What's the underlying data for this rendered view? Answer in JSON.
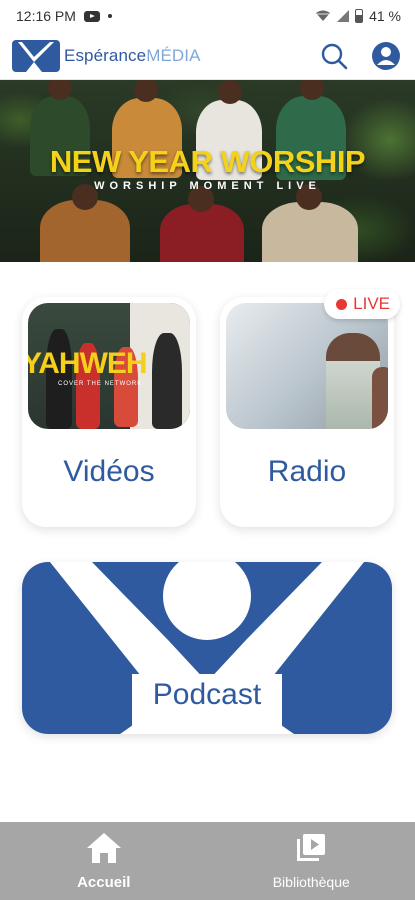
{
  "status_bar": {
    "time": "12:16 PM",
    "battery": "41 %",
    "icons": [
      "youtube-icon",
      "dot-icon",
      "wifi-icon",
      "signal-icon",
      "battery-icon"
    ]
  },
  "header": {
    "brand_primary": "Espérance",
    "brand_secondary": "MÉDIA",
    "actions": [
      "search-icon",
      "account-icon"
    ]
  },
  "hero": {
    "title": "NEW YEAR WORSHIP",
    "subtitle": "WORSHIP MOMENT LIVE"
  },
  "cards": {
    "videos": {
      "label": "Vidéos",
      "thumb_title": "YAHWEH",
      "thumb_subtitle": "COVER THE NETWORK"
    },
    "radio": {
      "label": "Radio",
      "badge": "LIVE"
    },
    "podcast": {
      "label": "Podcast"
    }
  },
  "bottom_nav": {
    "items": [
      {
        "label": "Accueil",
        "icon": "home-icon",
        "active": true
      },
      {
        "label": "Bibliothèque",
        "icon": "library-icon",
        "active": false
      }
    ]
  },
  "colors": {
    "brand_blue": "#2f5aa0",
    "live_red": "#e53935",
    "hero_title_yellow": "#f5d21a",
    "nav_bar_gray": "#a6a6a6"
  }
}
